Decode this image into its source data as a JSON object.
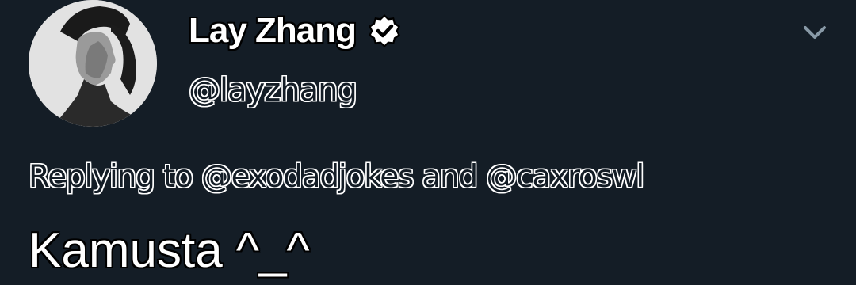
{
  "tweet": {
    "display_name": "Lay Zhang",
    "handle": "@layzhang",
    "replying_prefix": "Replying to",
    "replying_to_1": "@exodadjokes",
    "replying_connector": "and",
    "replying_to_2": "@caxroswl",
    "text": "Kamusta ^_^"
  },
  "icons": {
    "verified": "verified-badge-icon",
    "menu": "chevron-down-icon"
  },
  "colors": {
    "background": "#141d26",
    "text": "#ffffff",
    "chevron": "#8899a6"
  }
}
